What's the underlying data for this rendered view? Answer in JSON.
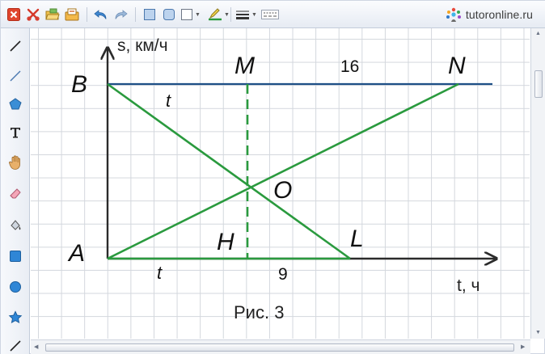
{
  "brand": {
    "name": "tutoronline.ru"
  },
  "toolbar": {
    "icons": [
      "close-icon",
      "delete-icon",
      "open-file-icon",
      "save-icon",
      "undo-icon",
      "redo-icon",
      "square-shape-icon",
      "rounded-square-icon",
      "fill-color-icon",
      "pen-color-icon",
      "line-width-icon",
      "line-style-icon"
    ]
  },
  "tools": [
    "pencil-tool",
    "line-tool",
    "polygon-tool",
    "text-tool",
    "hand-tool",
    "eraser-tool",
    "fill-tool",
    "rectangle-tool",
    "circle-tool",
    "star-tool",
    "brush-tool"
  ],
  "colors": {
    "axis": "#2b2b2b",
    "blue_line": "#1e4f86",
    "green": "#2a9a3e",
    "accent_blue": "#2f78c8"
  },
  "figure": {
    "y_axis_label": "s, км/ч",
    "x_axis_label": "t, ч",
    "points": {
      "A": "A",
      "B": "B",
      "M": "M",
      "N": "N",
      "O": "O",
      "H": "H",
      "L": "L"
    },
    "segment_labels": {
      "top_t": "t",
      "bottom_t": "t",
      "MN": "16",
      "HL": "9"
    },
    "caption": "Рис. 3"
  }
}
